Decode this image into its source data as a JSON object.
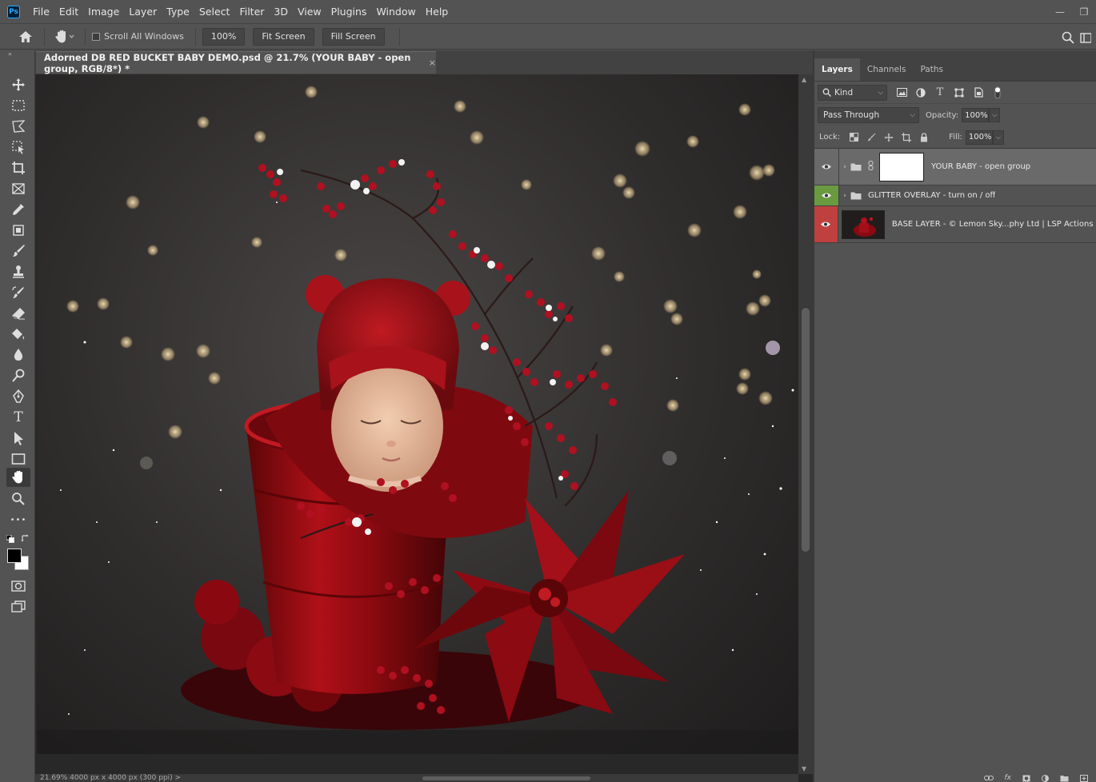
{
  "app": {
    "logo_text": "Ps"
  },
  "menu": [
    "File",
    "Edit",
    "Image",
    "Layer",
    "Type",
    "Select",
    "Filter",
    "3D",
    "View",
    "Plugins",
    "Window",
    "Help"
  ],
  "window_controls": {
    "minimize": "—",
    "restore": "❐"
  },
  "options_bar": {
    "scroll_all_windows_label": "Scroll All Windows",
    "zoom_100_label": "100%",
    "fit_screen_label": "Fit Screen",
    "fill_screen_label": "Fill Screen"
  },
  "document": {
    "tab_title": "Adorned DB RED BUCKET BABY DEMO.psd @ 21.7% (YOUR BABY - open group, RGB/8*) *",
    "close_glyph": "×",
    "status_text": "21.69%     4000 px x 4000 px (300 ppi)     >"
  },
  "toolbar": {
    "collapse_glyph": "»",
    "tools": [
      "move-tool",
      "marquee-tool",
      "lasso-tool",
      "object-select-tool",
      "crop-tool",
      "frame-tool",
      "eyedropper-tool",
      "frame-select-tool",
      "brush-tool",
      "stamp-tool",
      "history-brush-tool",
      "eraser-tool",
      "paint-bucket-tool",
      "blur-tool",
      "dodge-tool",
      "pen-tool",
      "type-tool",
      "path-select-tool",
      "rectangle-tool",
      "hand-tool",
      "zoom-tool",
      "more-tools"
    ],
    "active_tool": "hand-tool",
    "type_glyph": "T",
    "more_glyph": "•••"
  },
  "layers_panel": {
    "tabs": [
      "Layers",
      "Channels",
      "Paths"
    ],
    "active_tab": "Layers",
    "kind_label": "Kind",
    "blend_mode": "Pass Through",
    "opacity_label": "Opacity:",
    "opacity_value": "100%",
    "lock_label": "Lock:",
    "fill_label": "Fill:",
    "fill_value": "100%",
    "layers": [
      {
        "name": "YOUR BABY - open group",
        "type": "group-with-mask",
        "selected": true,
        "eye_color": "none"
      },
      {
        "name": "GLITTER OVERLAY - turn on / off",
        "type": "group",
        "selected": false,
        "eye_color": "#6a9a40"
      },
      {
        "name": "BASE LAYER - © Lemon Sky...phy Ltd | LSP Actions ®",
        "type": "image",
        "selected": false,
        "eye_color": "#c04040"
      }
    ],
    "bottom_icons": [
      "link-icon",
      "fx-icon",
      "mask-icon",
      "adjustment-icon",
      "group-icon",
      "new-layer-icon"
    ],
    "fx_glyph": "fx"
  },
  "colors": {
    "ui_bg": "#535353",
    "panel_dark": "#424242",
    "accent_blue": "#31a8ff",
    "berry_red": "#b01020",
    "bucket_red": "#9c0c14"
  }
}
